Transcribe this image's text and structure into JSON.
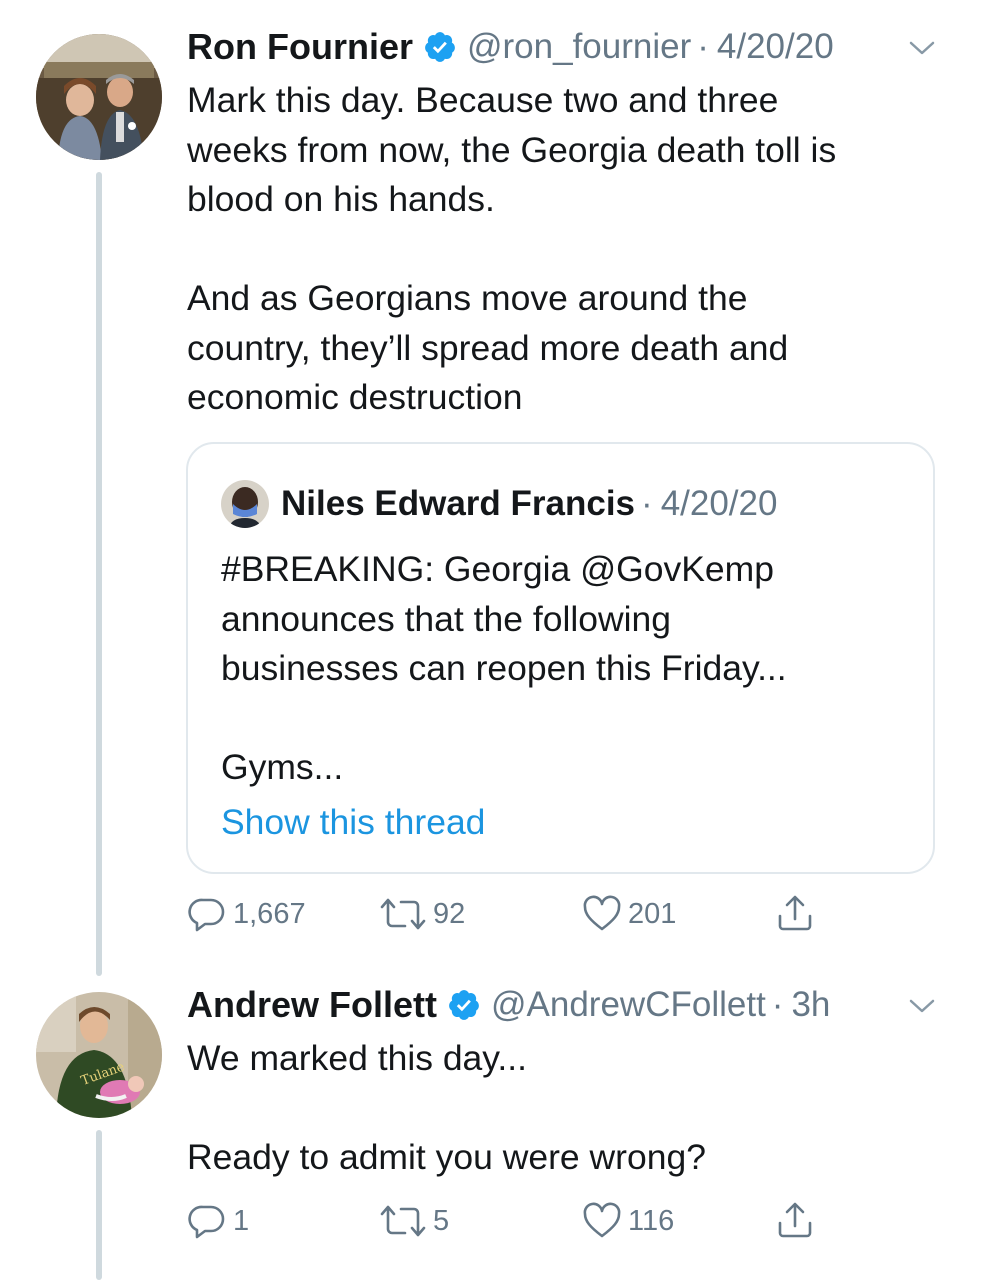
{
  "tweets": [
    {
      "display_name": "Ron Fournier",
      "handle": "@ron_fournier",
      "separator": "·",
      "date": "4/20/20",
      "text_lines": [
        "Mark this day. Because two and three",
        "weeks from now, the Georgia death toll is",
        "blood on his hands.",
        "",
        "And as Georgians move around the",
        "country, they’ll spread more death and",
        "economic destruction"
      ],
      "quote": {
        "display_name": "Niles Edward Francis",
        "separator": "·",
        "date": "4/20/20",
        "text_lines": [
          "#BREAKING: Georgia @GovKemp",
          "announces that the following",
          "businesses can reopen this Friday...",
          "",
          "Gyms..."
        ],
        "show_thread": "Show this thread"
      },
      "actions": {
        "replies": "1,667",
        "retweets": "92",
        "likes": "201"
      }
    },
    {
      "display_name": "Andrew Follett",
      "handle": "@AndrewCFollett",
      "separator": "·",
      "date": "3h",
      "text_lines": [
        "We marked this day...",
        "",
        "Ready to admit you were wrong?"
      ],
      "actions": {
        "replies": "1",
        "retweets": "5",
        "likes": "116"
      }
    }
  ],
  "icons": {
    "verified": "verified-badge-icon",
    "chevron": "chevron-down-icon",
    "reply": "reply-icon",
    "retweet": "retweet-icon",
    "like": "heart-icon",
    "share": "share-icon"
  },
  "colors": {
    "text": "#14171a",
    "secondary": "#657786",
    "link": "#1b95e0",
    "verified": "#1da1f2",
    "border": "#e1e8ed",
    "thread_line": "#cfd9de"
  }
}
